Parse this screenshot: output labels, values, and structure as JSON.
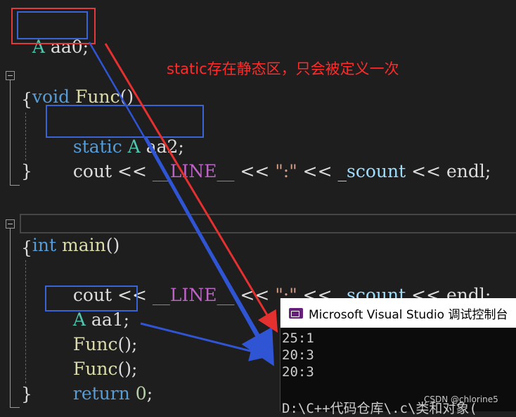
{
  "code": {
    "global_decl": {
      "type": "A",
      "name": " aa0",
      "semi": ";"
    },
    "func": {
      "ret": "void",
      "name": " Func",
      "parens": "()",
      "open": "{",
      "close": "}",
      "static_kw": "static",
      "static_type": " A",
      "static_name": " aa2",
      "static_semi": ";",
      "cout": "cout",
      "op1": " << ",
      "line_macro": "__LINE__",
      "op2": " << ",
      "str": "\":\"",
      "op3": " << ",
      "var": "_scount",
      "op4": " << ",
      "endl": "endl",
      "semi": ";"
    },
    "main": {
      "ret": "int",
      "name": " main",
      "parens": "()",
      "open": "{",
      "close": "}",
      "cout": "cout",
      "op1": " << ",
      "line_macro": "__LINE__",
      "op2": " << ",
      "str": "\":\"",
      "op3": " << ",
      "var": "_scount",
      "op4": " << ",
      "endl": "endl",
      "semi": ";",
      "local_type": "A",
      "local_name": " aa1",
      "local_semi": ";",
      "call1": "Func",
      "call1_rest": "();",
      "call2": "Func",
      "call2_rest": "();",
      "ret_kw": "return",
      "ret_val": " 0",
      "ret_semi": ";"
    }
  },
  "annotation": "static存在静态区，只会被定义一次",
  "console": {
    "title": "Microsoft Visual Studio 调试控制台",
    "lines": [
      "25:1",
      "20:3",
      "20:3"
    ],
    "path": "D:\\C++代码仓库\\.c\\类和对象( "
  },
  "watermark": "CSDN @chlorine5",
  "colors": {
    "box_blue": "#3a63d6",
    "box_red": "#e23a3a",
    "arrow_blue": "#2f55d4",
    "arrow_red": "#e53030"
  }
}
